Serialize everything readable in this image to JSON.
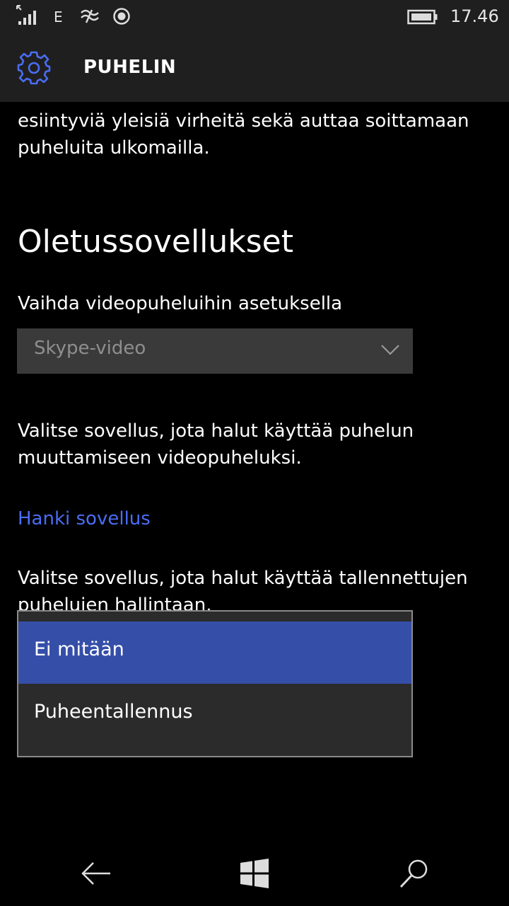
{
  "status_bar": {
    "network_type": "E",
    "time": "17.46",
    "icons": [
      "signal-icon",
      "wifi-icon",
      "location-icon",
      "battery-icon"
    ]
  },
  "header": {
    "title": "PUHELIN",
    "icon": "gear-icon",
    "accent_color": "#4a6df5"
  },
  "content": {
    "intro_text": "esiintyviä yleisiä virheitä sekä auttaa soittamaan puheluita ulkomailla.",
    "section_title": "Oletussovellukset",
    "video_label": "Vaihda videopuheluihin asetuksella",
    "video_select_value": "Skype-video",
    "video_description": "Valitse sovellus, jota halut käyttää puhelun muuttamiseen videopuheluksi.",
    "get_app_link": "Hanki sovellus",
    "recording_description": "Valitse sovellus, jota halut käyttää tallennettujen puhelujen hallintaan."
  },
  "dropdown": {
    "options": [
      {
        "label": "Ei mitään",
        "selected": true
      },
      {
        "label": "Puheentallennus",
        "selected": false
      }
    ],
    "selected_color": "#354ea8"
  },
  "nav_bar": {
    "icons": [
      "back-arrow-icon",
      "windows-start-icon",
      "search-icon"
    ]
  }
}
